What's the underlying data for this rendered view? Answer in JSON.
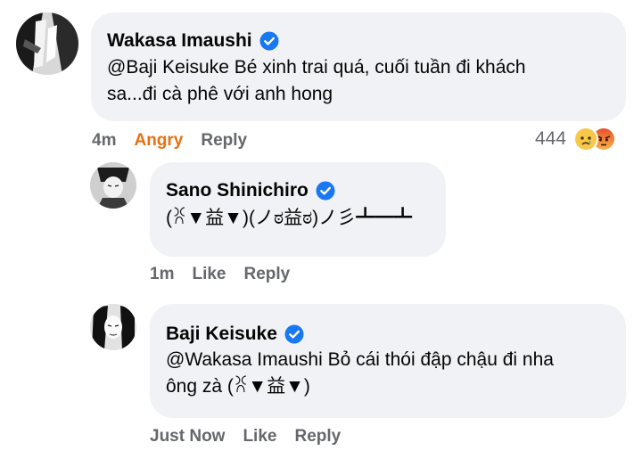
{
  "comments": [
    {
      "author": "Wakasa Imaushi",
      "text_line1": "@Baji Keisuke Bé xinh trai quá, cuối tuần đi khách",
      "text_line2": "sa...đi cà phê với anh hong",
      "time": "4m",
      "reaction_label": "Angry",
      "reply_label": "Reply",
      "reaction_count": "444",
      "reaction_icons": [
        "sad-face-icon",
        "angry-face-icon"
      ]
    },
    {
      "author": "Sano Shinichiro",
      "text_line1": "(ꐦ▼益▼)(ノಠ益ಠ)ノ彡┻━┻",
      "time": "1m",
      "like_label": "Like",
      "reply_label": "Reply"
    },
    {
      "author": "Baji Keisuke",
      "text_line1": "@Wakasa Imaushi Bỏ cái thói đập chậu đi nha",
      "text_line2": "ông zà (ꐦ▼益▼)",
      "time": "Just Now",
      "like_label": "Like",
      "reply_label": "Reply"
    }
  ],
  "colors": {
    "bubble": "#f0f2f5",
    "verified": "#1877f2",
    "meta_text": "#65676b",
    "angry_label": "#e9710f"
  }
}
